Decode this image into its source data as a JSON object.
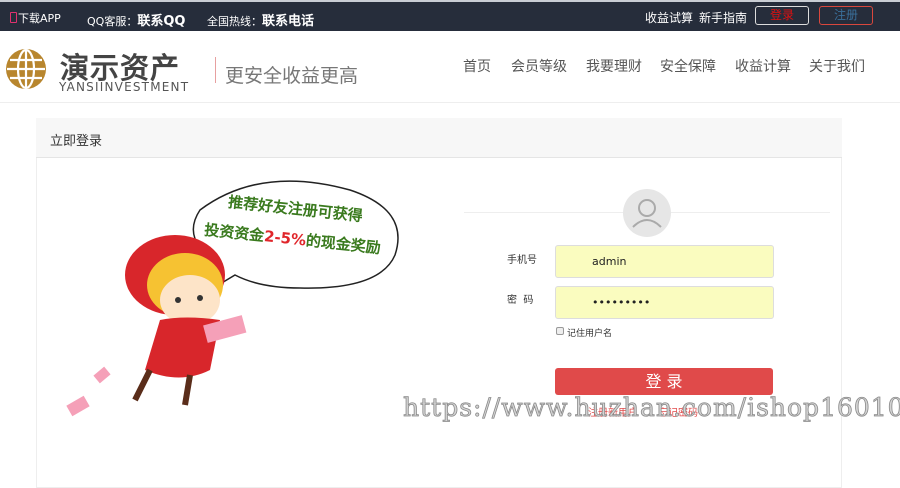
{
  "topbar": {
    "download": "下载APP",
    "qq_label": "QQ客服：",
    "qq_value": "联系QQ",
    "hotline_label": "全国热线：",
    "hotline_value": "联系电话",
    "calc": "收益试算",
    "guide": "新手指南",
    "login": "登录",
    "register": "注册"
  },
  "brand": {
    "name": "演示资产",
    "sub": "YANSIINVESTMENT",
    "slogan": "更安全收益更高"
  },
  "nav": [
    "首页",
    "会员等级",
    "我要理财",
    "安全保障",
    "收益计算",
    "关于我们"
  ],
  "panel": {
    "title": "立即登录"
  },
  "promo": {
    "line1": "推荐好友注册可获得",
    "line2a": "投资资金",
    "line2b": "2-5%",
    "line2c": "的现金奖励"
  },
  "form": {
    "phone_label": "手机号",
    "phone_value": "admin",
    "password_label": "密  码",
    "password_value": "•••••••••",
    "remember": "记住用户名",
    "submit": "登 录",
    "register_link": "注册新用户",
    "forgot_link": "忘记密码"
  },
  "watermark": "https://www.huzhan.com/ishop16010",
  "colors": {
    "topbar": "#262d3b",
    "accent": "#e04a4a",
    "input_bg": "#fafcbf",
    "gold": "#b8862e"
  }
}
